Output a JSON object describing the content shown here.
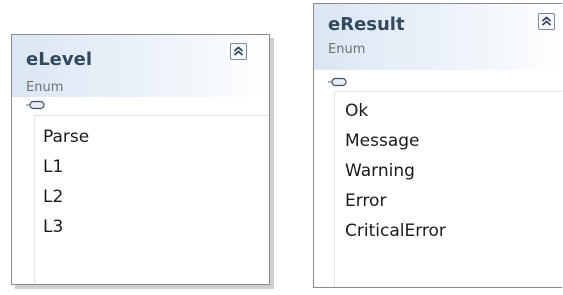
{
  "shapes": {
    "level": {
      "name": "eLevel",
      "kind": "Enum",
      "members": [
        "Parse",
        "L1",
        "L2",
        "L3"
      ]
    },
    "result": {
      "name": "eResult",
      "kind": "Enum",
      "members": [
        "Ok",
        "Message",
        "Warning",
        "Error",
        "CriticalError"
      ]
    }
  },
  "icons": {
    "collapse": "double-chevron-up-icon",
    "members_toggle": "members-toggle-icon"
  },
  "colors": {
    "header_gradient_start": "#dbe6f4",
    "title": "#33495e",
    "stereotype": "#707070",
    "border": "#8c8c8c"
  }
}
